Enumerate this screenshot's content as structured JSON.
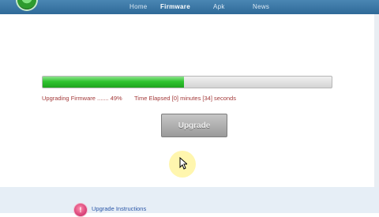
{
  "nav": {
    "items": [
      {
        "label": "Home",
        "active": false
      },
      {
        "label": "Firmware",
        "active": true
      },
      {
        "label": "Apk",
        "active": false
      },
      {
        "label": "News",
        "active": false
      }
    ]
  },
  "upgrade": {
    "status_text": "Upgrading Firmware ....... 49%",
    "progress_fraction": 0.49,
    "elapsed_text": "Time Elapsed [0] minutes [34] seconds",
    "button_label": "Upgrade"
  },
  "footer": {
    "instructions_label": "Upgrade Instructions"
  },
  "colors": {
    "nav_bar": "#3a78a8",
    "progress_fill": "#2fc42f",
    "status_text": "#a33a3a",
    "link": "#2b57a8"
  },
  "icons": {
    "logo": "app-logo-icon",
    "cursor": "mouse-cursor-icon",
    "instructions": "info-icon"
  }
}
